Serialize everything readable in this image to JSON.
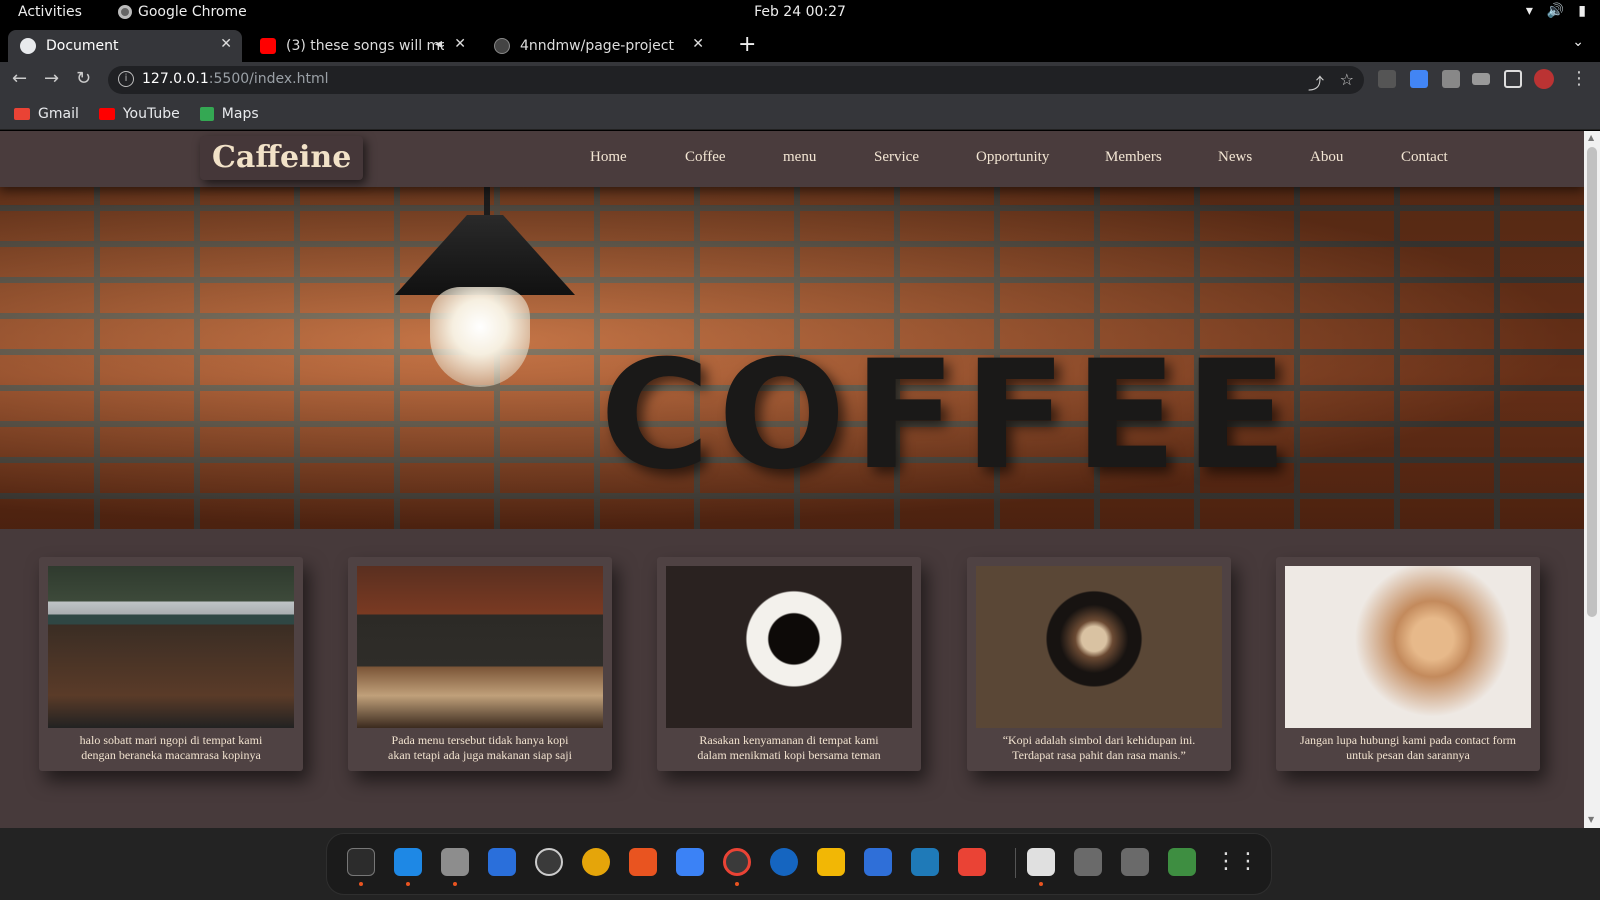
{
  "system_bar": {
    "activities": "Activities",
    "app_name": "Google Chrome",
    "clock": "Feb 24  00:27"
  },
  "browser": {
    "tabs": [
      {
        "title": "Document",
        "close": "✕",
        "active": true
      },
      {
        "title": "(3) these songs will ma",
        "close": "✕",
        "active": false
      },
      {
        "title": "4nndmw/page-project",
        "close": "✕",
        "active": false
      }
    ],
    "new_tab": "+",
    "url_host": "127.0.0.1",
    "url_rest": ":5500/index.html",
    "bookmarks": [
      {
        "label": "Gmail",
        "color": "#ea4335"
      },
      {
        "label": "YouTube",
        "color": "#ff0000"
      },
      {
        "label": "Maps",
        "color": "#34a853"
      }
    ]
  },
  "site": {
    "logo": "Caffeine",
    "nav": [
      "Home",
      "Coffee",
      "menu",
      "Service",
      "Opportunity",
      "Members",
      "News",
      "Abou",
      "Contact"
    ],
    "hero_text": "COFFEE",
    "cards": [
      {
        "caption_line1": "halo sobatt mari ngopi di tempat kami",
        "caption_line2": "dengan beraneka macamrasa kopinya"
      },
      {
        "caption_line1": "Pada menu tersebut tidak hanya kopi",
        "caption_line2": "akan tetapi ada juga makanan siap saji"
      },
      {
        "caption_line1": "Rasakan kenyamanan di tempat kami",
        "caption_line2": "dalam menikmati kopi bersama teman"
      },
      {
        "caption_line1": "“Kopi adalah simbol dari kehidupan ini.",
        "caption_line2": "Terdapat rasa pahit dan rasa manis.”"
      },
      {
        "caption_line1": "Jangan lupa hubungi kami pada contact form",
        "caption_line2": "untuk pesan dan sarannya"
      }
    ]
  },
  "colors": {
    "page_bg": "#473a3b",
    "header_bg": "#4a3c3d",
    "logo_text": "#f2e2c8",
    "nav_text": "#f3e6d4"
  }
}
